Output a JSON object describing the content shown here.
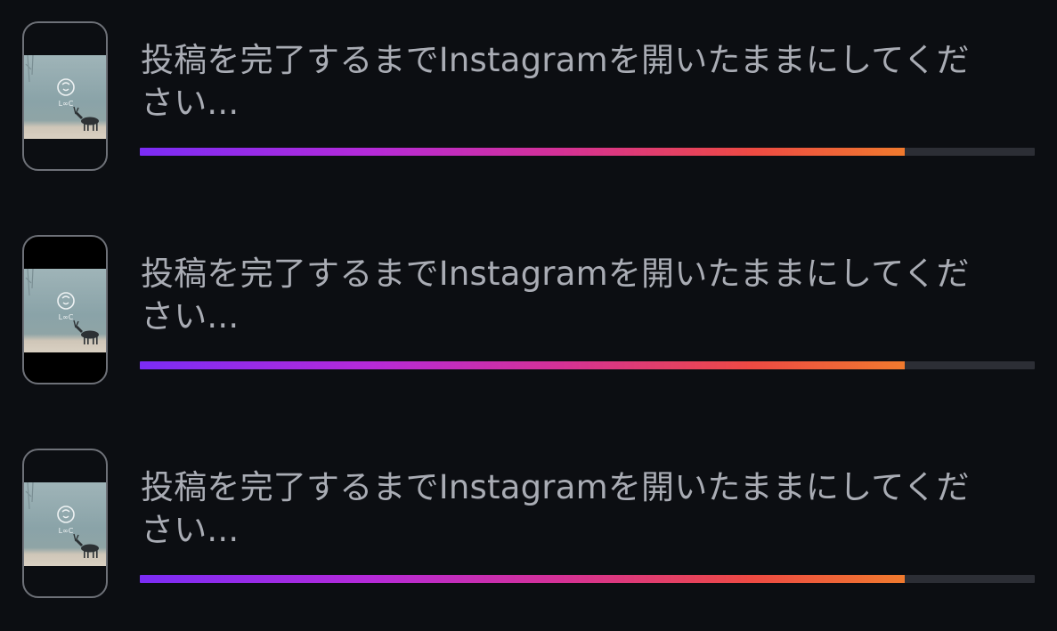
{
  "uploads": [
    {
      "status_text": "投稿を完了するまでInstagramを開いたままにしてください...",
      "progress": 0.855,
      "thumbnail_logo_text": "L∞C",
      "thumbnail_letterboxed": false
    },
    {
      "status_text": "投稿を完了するまでInstagramを開いたままにしてください...",
      "progress": 0.855,
      "thumbnail_logo_text": "L∞C",
      "thumbnail_letterboxed": true
    },
    {
      "status_text": "投稿を完了するまでInstagramを開いたままにしてください...",
      "progress": 0.855,
      "thumbnail_logo_text": "L∞C",
      "thumbnail_letterboxed": false
    }
  ],
  "colors": {
    "background": "#0c0e12",
    "text": "#a9acb4",
    "track": "#2c2e35",
    "gradient_start": "#7b2cf5",
    "gradient_end": "#f07a2e"
  },
  "icons": {
    "thumbnail": "deer-photo-thumbnail"
  }
}
